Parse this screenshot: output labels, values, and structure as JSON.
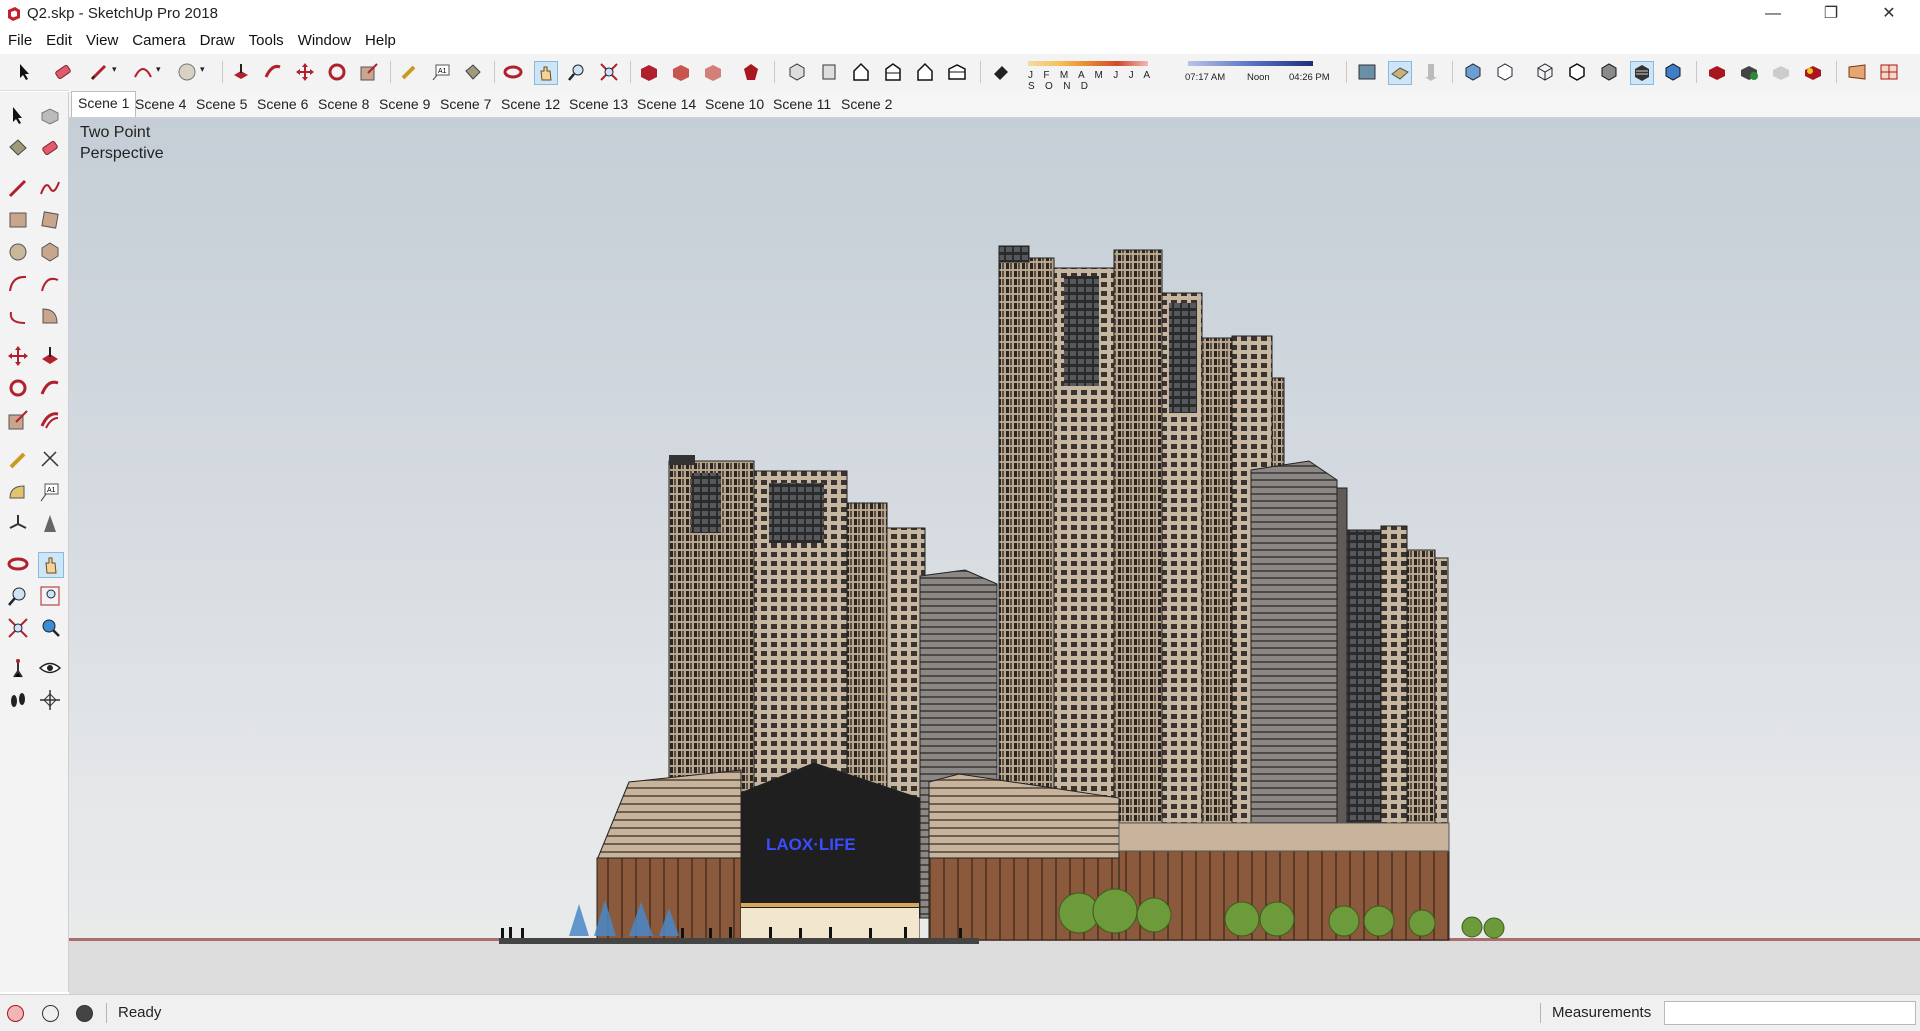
{
  "window": {
    "title": "Q2.skp - SketchUp Pro 2018",
    "minimize": "—",
    "restore": "❐",
    "close": "✕"
  },
  "menu": [
    "File",
    "Edit",
    "View",
    "Camera",
    "Draw",
    "Tools",
    "Window",
    "Help"
  ],
  "shadow": {
    "months": "J F M A M J J A S O N D",
    "time_start": "07:17 AM",
    "time_noon": "Noon",
    "time_end": "04:26 PM"
  },
  "scenes": [
    "Scene 1",
    "Scene 4",
    "Scene 5",
    "Scene 6",
    "Scene 8",
    "Scene 9",
    "Scene 7",
    "Scene 12",
    "Scene 13",
    "Scene 14",
    "Scene 10",
    "Scene 11",
    "Scene 2"
  ],
  "active_scene": "Scene 1",
  "viewport": {
    "camera_label": "Two Point\nPerspective",
    "sign_text": "LAOX·LIFE"
  },
  "status": {
    "text": "Ready",
    "measurements_label": "Measurements",
    "measurements_value": ""
  },
  "colors": {
    "accent": "#c7202e",
    "tower": "#c9b9a3",
    "tower_dark": "#2b2b2b",
    "podium": "#8b5a3c"
  }
}
